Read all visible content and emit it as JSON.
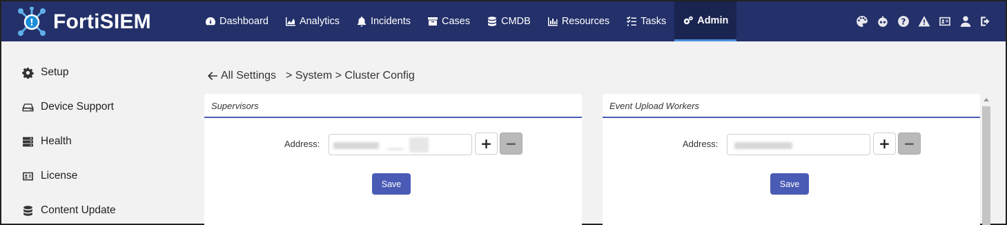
{
  "app": {
    "name": "FortiSIEM"
  },
  "nav": {
    "items": [
      {
        "label": "Dashboard",
        "icon": "dashboard-icon"
      },
      {
        "label": "Analytics",
        "icon": "area-chart-icon"
      },
      {
        "label": "Incidents",
        "icon": "bell-icon"
      },
      {
        "label": "Cases",
        "icon": "archive-icon"
      },
      {
        "label": "CMDB",
        "icon": "database-icon"
      },
      {
        "label": "Resources",
        "icon": "bar-chart-icon"
      },
      {
        "label": "Tasks",
        "icon": "tasks-icon"
      },
      {
        "label": "Admin",
        "icon": "cogs-icon",
        "active": true
      }
    ],
    "right_icons": [
      "palette-icon",
      "bot-icon",
      "help-icon",
      "warning-icon",
      "id-card-icon",
      "user-icon",
      "logout-icon"
    ]
  },
  "sidebar": {
    "items": [
      {
        "label": "Setup",
        "icon": "gear-icon"
      },
      {
        "label": "Device Support",
        "icon": "hard-drive-icon"
      },
      {
        "label": "Health",
        "icon": "server-icon"
      },
      {
        "label": "License",
        "icon": "id-card-icon"
      },
      {
        "label": "Content Update",
        "icon": "database-icon"
      }
    ]
  },
  "breadcrumb": {
    "back_label": "All Settings",
    "path": "> System > Cluster Config"
  },
  "panels": {
    "supervisors": {
      "title": "Supervisors",
      "address_label": "Address:",
      "add_label": "+",
      "remove_label": "−",
      "save_label": "Save"
    },
    "workers": {
      "title": "Event Upload Workers",
      "address_label": "Address:",
      "add_label": "+",
      "remove_label": "−",
      "save_label": "Save"
    }
  },
  "colors": {
    "topbar": "#233069",
    "accent": "#4a5bb5",
    "background": "#f2f2f2"
  }
}
